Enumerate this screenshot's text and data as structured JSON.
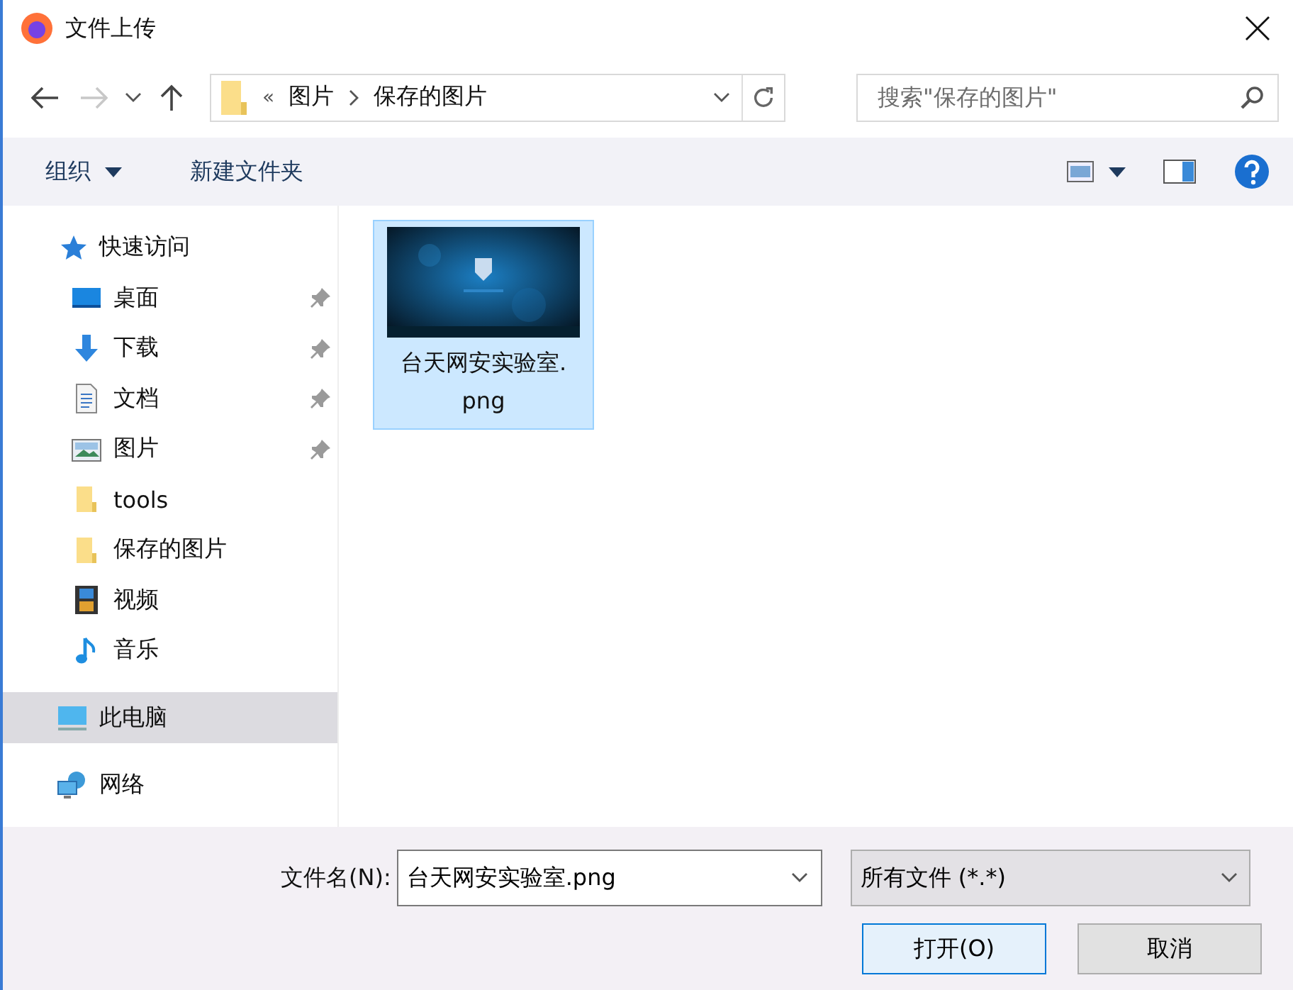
{
  "window": {
    "title": "文件上传"
  },
  "address": {
    "overflow": "«",
    "crumbs": [
      "图片",
      "保存的图片"
    ]
  },
  "search": {
    "placeholder": "搜索\"保存的图片\""
  },
  "toolbar": {
    "organize": "组织",
    "new_folder": "新建文件夹"
  },
  "sidebar": {
    "items": [
      {
        "label": "快速访问",
        "kind": "star",
        "selected": false,
        "children": [
          {
            "label": "桌面",
            "kind": "desktop",
            "pinned": true,
            "selected": false
          },
          {
            "label": "下载",
            "kind": "download",
            "pinned": true,
            "selected": false
          },
          {
            "label": "文档",
            "kind": "document",
            "pinned": true,
            "selected": false
          },
          {
            "label": "图片",
            "kind": "pictures",
            "pinned": true,
            "selected": false
          },
          {
            "label": "tools",
            "kind": "folder",
            "pinned": false,
            "selected": false
          },
          {
            "label": "保存的图片",
            "kind": "folder",
            "pinned": false,
            "selected": false
          },
          {
            "label": "视频",
            "kind": "video",
            "pinned": false,
            "selected": false
          },
          {
            "label": "音乐",
            "kind": "music",
            "pinned": false,
            "selected": false
          }
        ]
      },
      {
        "label": "此电脑",
        "kind": "computer",
        "selected": true
      },
      {
        "label": "网络",
        "kind": "network",
        "selected": false
      }
    ]
  },
  "files": [
    {
      "name": "台天网安实验室.\npng",
      "kind": "picture",
      "selected": true
    }
  ],
  "footer": {
    "filename_label": "文件名(N):",
    "filename": "台天网安实验室.png",
    "filter": "所有文件 (*.*)",
    "open_button": "打开(O)",
    "cancel_button": "取消"
  }
}
